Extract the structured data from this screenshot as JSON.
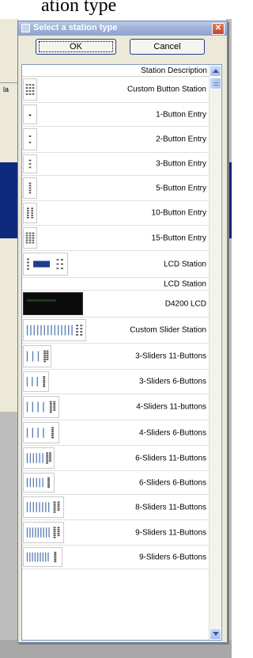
{
  "background": {
    "top_text": "ation type",
    "left_label": "la"
  },
  "dialog": {
    "title": "Select a station type",
    "ok_label": "OK",
    "cancel_label": "Cancel",
    "list_header": "Station Description",
    "rows": [
      {
        "label": "Custom Button Station",
        "thumb": "grid"
      },
      {
        "label": "1-Button Entry",
        "thumb": "b1"
      },
      {
        "label": "2-Button Entry",
        "thumb": "b2"
      },
      {
        "label": "3-Button Entry",
        "thumb": "b3"
      },
      {
        "label": "5-Button Entry",
        "thumb": "b5"
      },
      {
        "label": "10-Button Entry",
        "thumb": "b10"
      },
      {
        "label": "15-Button Entry",
        "thumb": "b15"
      },
      {
        "label": "LCD Station",
        "thumb": "lcd"
      },
      {
        "label": "LCD Station",
        "thumb": "none"
      },
      {
        "label": "D4200 LCD",
        "thumb": "d4200"
      },
      {
        "label": "Custom Slider Station",
        "thumb": "slider-custom"
      },
      {
        "label": "3-Sliders 11-Buttons",
        "thumb": "s3b11"
      },
      {
        "label": "3-Sliders 6-Buttons",
        "thumb": "s3b6"
      },
      {
        "label": "4-Sliders 11-buttons",
        "thumb": "s4b11"
      },
      {
        "label": "4-Sliders 6-Buttons",
        "thumb": "s4b6"
      },
      {
        "label": "6-Sliders 11-Buttons",
        "thumb": "s6b11"
      },
      {
        "label": "6-Sliders 6-Buttons",
        "thumb": "s6b6"
      },
      {
        "label": "8-Sliders 11-Buttons",
        "thumb": "s8b11"
      },
      {
        "label": "9-Sliders 11-Buttons",
        "thumb": "s9b11"
      },
      {
        "label": "9-Sliders 6-Buttons",
        "thumb": "s9b6"
      }
    ]
  }
}
